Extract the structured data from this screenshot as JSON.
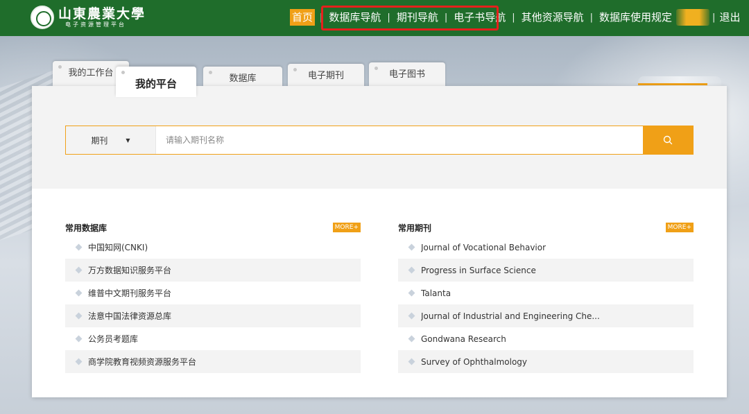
{
  "header": {
    "logo_name": "山東農業大學",
    "logo_sub": "电子资源管理平台",
    "nav": [
      {
        "label": "首页",
        "active": true
      },
      {
        "label": "数据库导航"
      },
      {
        "label": "期刊导航"
      },
      {
        "label": "电子书导航"
      },
      {
        "label": "其他资源导航"
      },
      {
        "label": "数据库使用规定"
      },
      {
        "label": "退出"
      }
    ],
    "separator": "|",
    "colors": {
      "bar": "#1f6d2b",
      "accent": "#f0a017",
      "highlight": "#e5201c"
    }
  },
  "tabs": [
    "我的工作台",
    "我的平台",
    "数据库",
    "电子期刊",
    "电子图书"
  ],
  "search": {
    "type_label": "期刊",
    "placeholder": "请输入期刊名称",
    "icon": "search-icon"
  },
  "left_list": {
    "title": "常用数据库",
    "more": "MORE+",
    "items": [
      "中国知网(CNKI)",
      "万方数据知识服务平台",
      "维普中文期刊服务平台",
      "法意中国法律资源总库",
      "公务员考题库",
      "商学院教育视频资源服务平台"
    ]
  },
  "right_list": {
    "title": "常用期刊",
    "more": "MORE+",
    "items": [
      "Journal of Vocational Behavior",
      "Progress in Surface Science",
      "Talanta",
      "Journal of Industrial and Engineering Che...",
      "Gondwana Research",
      "Survey of Ophthalmology"
    ]
  }
}
